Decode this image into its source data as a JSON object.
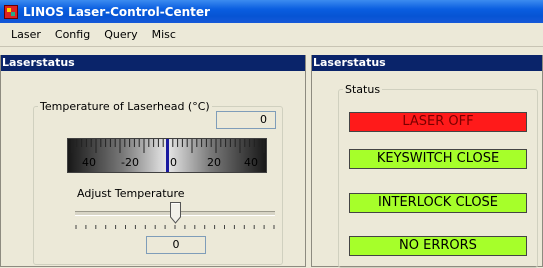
{
  "window": {
    "title": "LINOS Laser-Control-Center"
  },
  "menu": [
    "Laser",
    "Config",
    "Query",
    "Misc"
  ],
  "left_panel": {
    "header": "Laserstatus",
    "temperature_group": "Temperature of Laserhead (°C)",
    "temperature_value": "0",
    "gauge_scale": [
      "40",
      "-20",
      "0",
      "20",
      "40"
    ],
    "gauge_reading_celsius": 0,
    "adjust_label": "Adjust Temperature",
    "adjust_value": "0",
    "slider_fraction": 0.5
  },
  "right_panel": {
    "header": "Laserstatus",
    "status_group": "Status",
    "indicators": [
      {
        "label": "LASER OFF",
        "color": "#ff1a1a",
        "text_color": "#7a0000"
      },
      {
        "label": "KEYSWITCH CLOSE",
        "color": "#a6ff2a",
        "text_color": "#000000"
      },
      {
        "label": "INTERLOCK CLOSE",
        "color": "#a6ff2a",
        "text_color": "#000000"
      },
      {
        "label": "NO ERRORS",
        "color": "#a6ff2a",
        "text_color": "#000000"
      }
    ]
  }
}
